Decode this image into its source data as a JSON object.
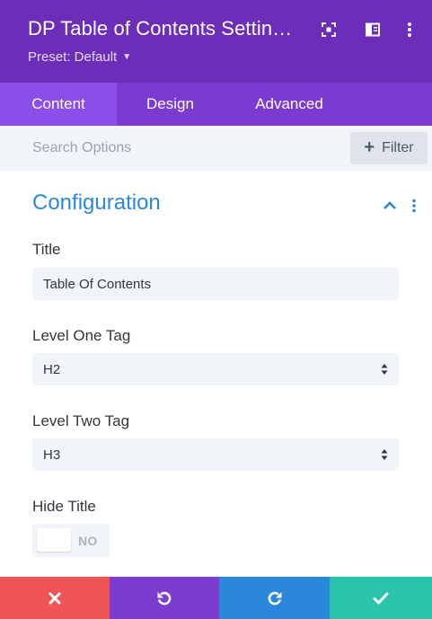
{
  "header": {
    "title": "DP Table of Contents Settin…",
    "preset_label": "Preset: Default",
    "icons": [
      "expand-icon",
      "sidebar-icon",
      "more-vertical-icon"
    ]
  },
  "tabs": [
    {
      "label": "Content",
      "active": true
    },
    {
      "label": "Design",
      "active": false
    },
    {
      "label": "Advanced",
      "active": false
    }
  ],
  "search": {
    "placeholder": "Search Options",
    "filter_label": "Filter"
  },
  "section": {
    "title": "Configuration",
    "expanded": true
  },
  "fields": {
    "title": {
      "label": "Title",
      "value": "Table Of Contents"
    },
    "level_one_tag": {
      "label": "Level One Tag",
      "value": "H2"
    },
    "level_two_tag": {
      "label": "Level Two Tag",
      "value": "H3"
    },
    "hide_title": {
      "label": "Hide Title",
      "value": "NO"
    }
  },
  "footer": {
    "buttons": [
      "discard-icon",
      "undo-icon",
      "redo-icon",
      "save-icon"
    ]
  },
  "colors": {
    "header_bg": "#6c2eb9",
    "tabs_bg": "#7b3bd1",
    "active_tab_bg": "#8c4ee8",
    "accent_blue": "#2b87da",
    "discard_red": "#ef5555",
    "undo_purple": "#7e3bd0",
    "save_green": "#29c4a9"
  }
}
